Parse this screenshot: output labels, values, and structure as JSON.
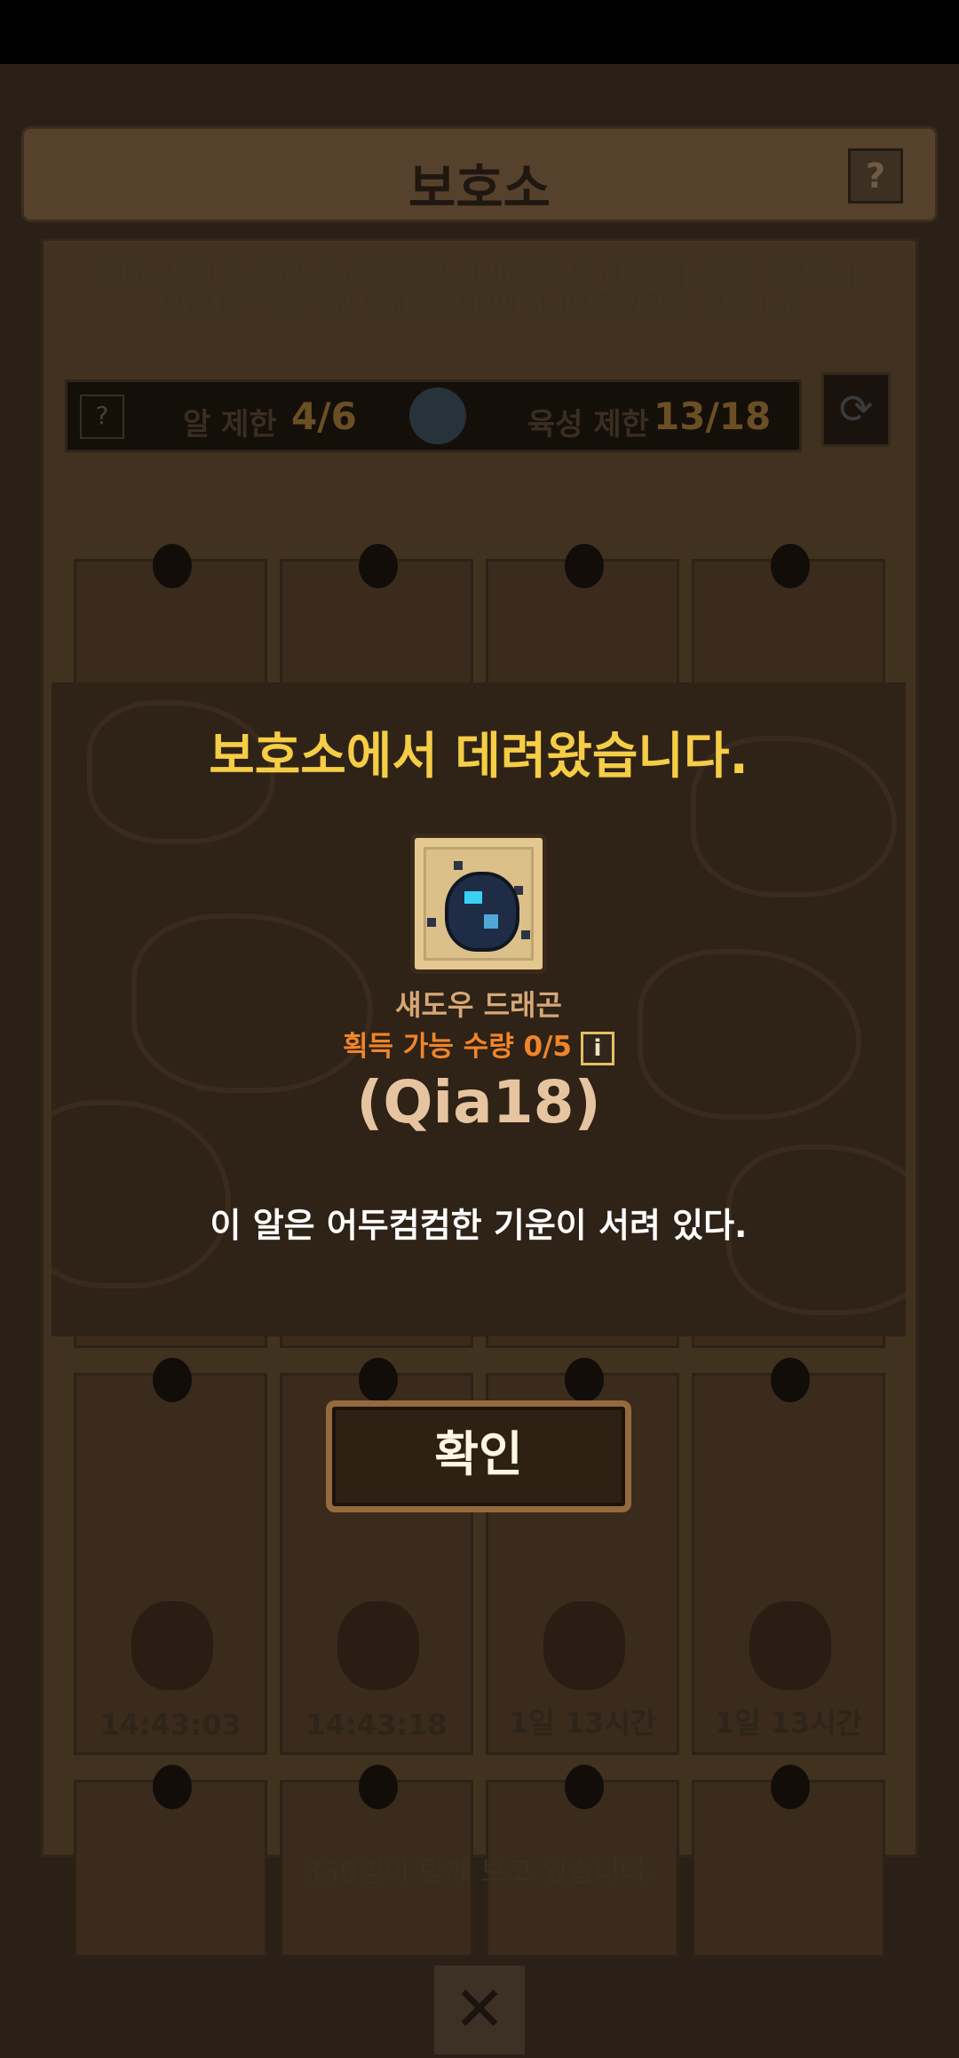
{
  "screen": {
    "title": "보호소",
    "help_label": "?",
    "description": "일반 사용자 소유 이득 드래곤은 일정기간이 지나면 이곳에서 새로운 주인을 기다립니다. 보호 중인 드래곤은 시간이 지나면 입양 할 수 있습니다.",
    "limits": {
      "help_label": "?",
      "egg_limit_label": "알 제한",
      "egg_limit_value": "4/6",
      "raise_limit_label": "육성 제한",
      "raise_limit_value": "13/18"
    },
    "refresh_icon": "refresh-icon",
    "slots_row3": [
      {
        "timer": "14:43:03"
      },
      {
        "timer": "14:43:18"
      },
      {
        "timer": "1일 13시간"
      },
      {
        "timer": "1일 13시간"
      }
    ],
    "footer_text": "330명이 함께 보고 있습니다.",
    "close_label": "✕"
  },
  "dialog": {
    "title": "보호소에서 데려왔습니다.",
    "item_name": "섀도우 드래곤",
    "acquire_label": "획득 가능 수량 0/5",
    "info_label": "i",
    "code": "(Qia18)",
    "flavor_text": "이 알은 어두컴컴한 기운이 서려 있다.",
    "confirm_label": "확인"
  },
  "colors": {
    "title_yellow": "#f5cd46",
    "acquire_orange": "#f0852a",
    "dialog_bg": "#2f2216"
  }
}
